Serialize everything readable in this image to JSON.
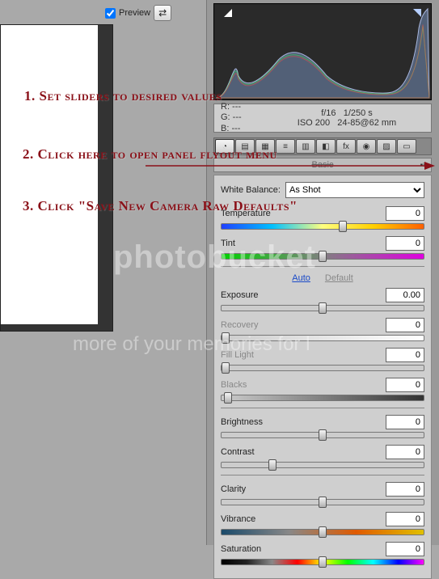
{
  "preview": {
    "label": "Preview",
    "checked": true
  },
  "exif": {
    "r": "R: ---",
    "g": "G: ---",
    "b": "B: ---",
    "aperture": "f/16",
    "shutter": "1/250 s",
    "iso": "ISO 200",
    "lens": "24-85@62 mm"
  },
  "panel_title": "Basic",
  "wb": {
    "label": "White Balance:",
    "selected": "As Shot"
  },
  "sliders": {
    "temperature": {
      "label": "Temperature",
      "value": "0",
      "pos": 60
    },
    "tint": {
      "label": "Tint",
      "value": "0",
      "pos": 50
    },
    "exposure": {
      "label": "Exposure",
      "value": "0.00",
      "pos": 50
    },
    "recovery": {
      "label": "Recovery",
      "value": "0",
      "pos": 2
    },
    "fill": {
      "label": "Fill Light",
      "value": "0",
      "pos": 2
    },
    "blacks": {
      "label": "Blacks",
      "value": "0",
      "pos": 3
    },
    "brightness": {
      "label": "Brightness",
      "value": "0",
      "pos": 50
    },
    "contrast": {
      "label": "Contrast",
      "value": "0",
      "pos": 25
    },
    "clarity": {
      "label": "Clarity",
      "value": "0",
      "pos": 50
    },
    "vibrance": {
      "label": "Vibrance",
      "value": "0",
      "pos": 50
    },
    "saturation": {
      "label": "Saturation",
      "value": "0",
      "pos": 50
    }
  },
  "links": {
    "auto": "Auto",
    "default": "Default"
  },
  "tabs": [
    "◔",
    "▤",
    "▦",
    "≡",
    "▥",
    "◧",
    "fx",
    "◉",
    "▨",
    "▭"
  ],
  "annotations": {
    "a1": "1. Set sliders to desired values",
    "a2": "2. Click here to open panel flyout menu",
    "a3": "3. Click \"Save New Camera Raw Defaults\""
  },
  "watermark": {
    "w1": "photobucket",
    "w2": "more of your memories for l"
  }
}
